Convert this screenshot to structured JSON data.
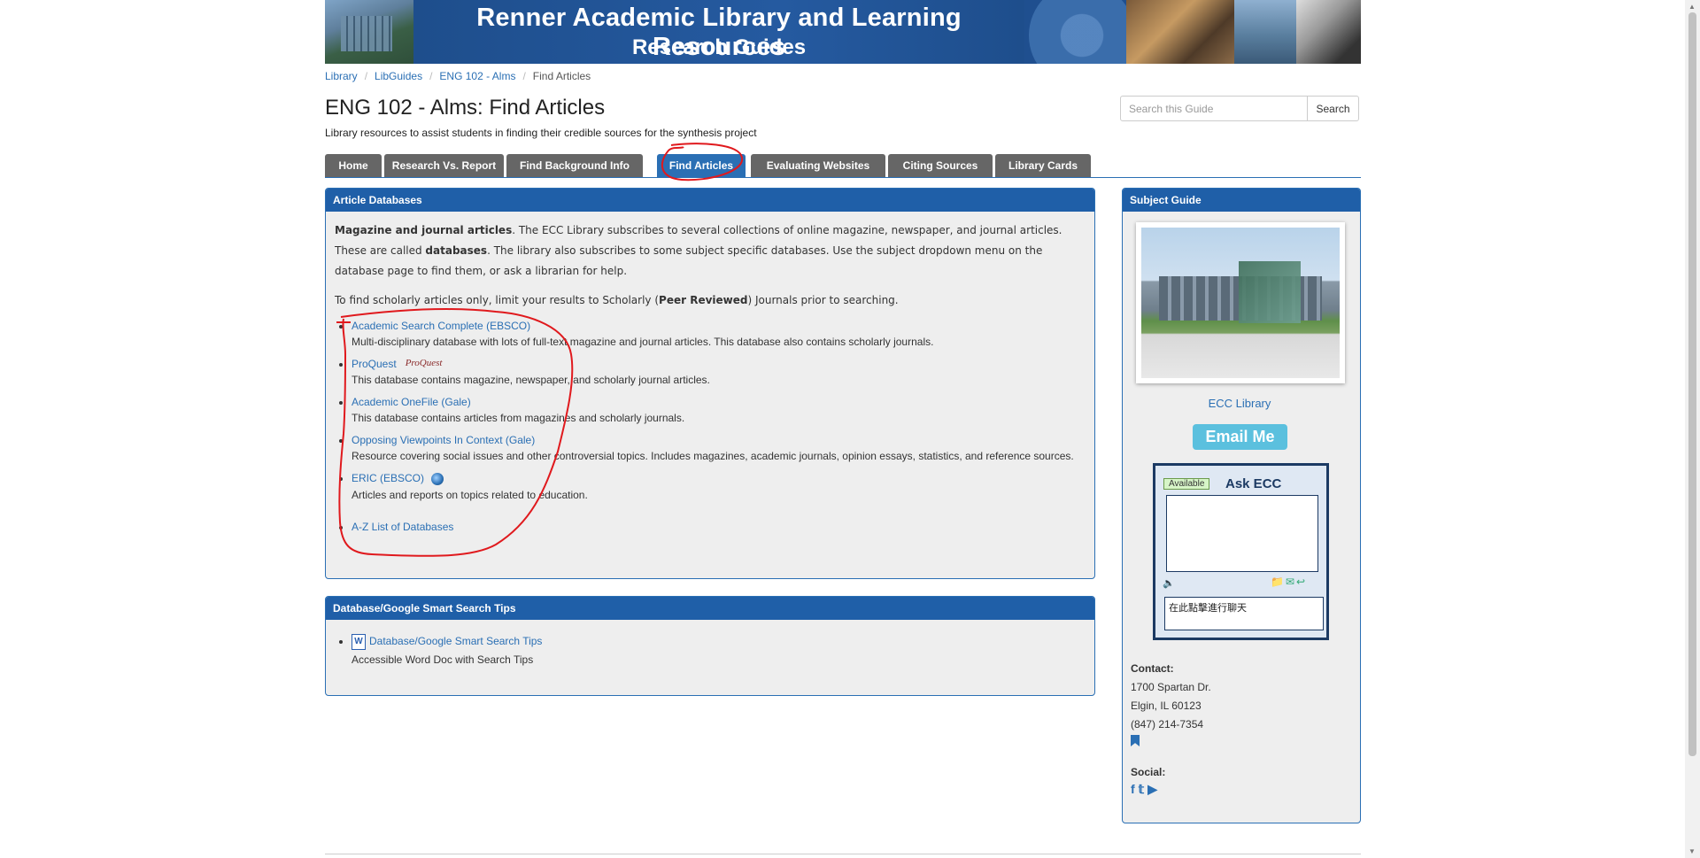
{
  "banner": {
    "title": "Renner Academic Library and Learning Resources",
    "subtitle": "Research Guides"
  },
  "breadcrumb": [
    "Library",
    "LibGuides",
    "ENG 102 - Alms",
    "Find Articles"
  ],
  "page": {
    "title": "ENG 102 - Alms: Find Articles",
    "subtitle": "Library resources to assist students in finding their credible sources for the synthesis project"
  },
  "search": {
    "placeholder": "Search this Guide",
    "button": "Search"
  },
  "tabs": [
    {
      "label": "Home"
    },
    {
      "label": "Research Vs. Report"
    },
    {
      "label": "Find Background Info"
    },
    {
      "label": "Find Articles",
      "active": true
    },
    {
      "label": "Evaluating Websites"
    },
    {
      "label": "Citing Sources"
    },
    {
      "label": "Library Cards"
    }
  ],
  "article_databases": {
    "heading": "Article Databases",
    "intro": {
      "bold1": "Magazine and journal articles",
      "text1": ". The ECC Library subscribes to several collections of online magazine, newspaper, and journal articles. These are called ",
      "bold2": "databases",
      "text2": ". The library also subscribes to some subject specific databases. Use the subject dropdown menu on the database page to find them, or ask a librarian for help."
    },
    "scholarly": {
      "text1": "To find scholarly articles only, limit your results to Scholarly (",
      "bold": "Peer Reviewed",
      "text2": ") Journals prior to searching."
    },
    "databases": [
      {
        "name": "Academic Search Complete (EBSCO)",
        "desc": "Multi-disciplinary database with lots of full-text magazine and journal articles. This database also contains scholarly journals."
      },
      {
        "name": "ProQuest",
        "logo": "ProQuest",
        "desc": "This database contains magazine, newspaper, and scholarly journal articles."
      },
      {
        "name": "Academic OneFile (Gale)",
        "desc": "This database contains articles from magazines and scholarly journals."
      },
      {
        "name": "Opposing Viewpoints In Context (Gale)",
        "desc": "Resource covering social issues and other controversial topics. Includes magazines, academic journals, opinion essays, statistics, and reference sources."
      },
      {
        "name": "ERIC (EBSCO)",
        "desc": "Articles and reports on topics related to education."
      },
      {
        "name": "A-Z List of Databases",
        "desc": ""
      }
    ]
  },
  "tips": {
    "heading": "Database/Google Smart Search Tips",
    "link": "Database/Google Smart Search Tips",
    "icon_letter": "W",
    "desc": "Accessible Word Doc with Search Tips"
  },
  "sidebar": {
    "heading": "Subject Guide",
    "owner": "ECC Library",
    "email_button": "Email Me",
    "chat": {
      "status": "Available",
      "title": "Ask ECC",
      "input_text": "在此點擊進行聊天"
    },
    "contact": {
      "label": "Contact:",
      "lines": [
        "1700 Spartan Dr.",
        "Elgin, IL 60123",
        "(847) 214-7354"
      ]
    },
    "social_label": "Social:"
  },
  "colors": {
    "accent": "#2a6fb4",
    "panel_header": "#1f5fa8",
    "tab_inactive": "#666666",
    "annotation": "#e0191d"
  }
}
